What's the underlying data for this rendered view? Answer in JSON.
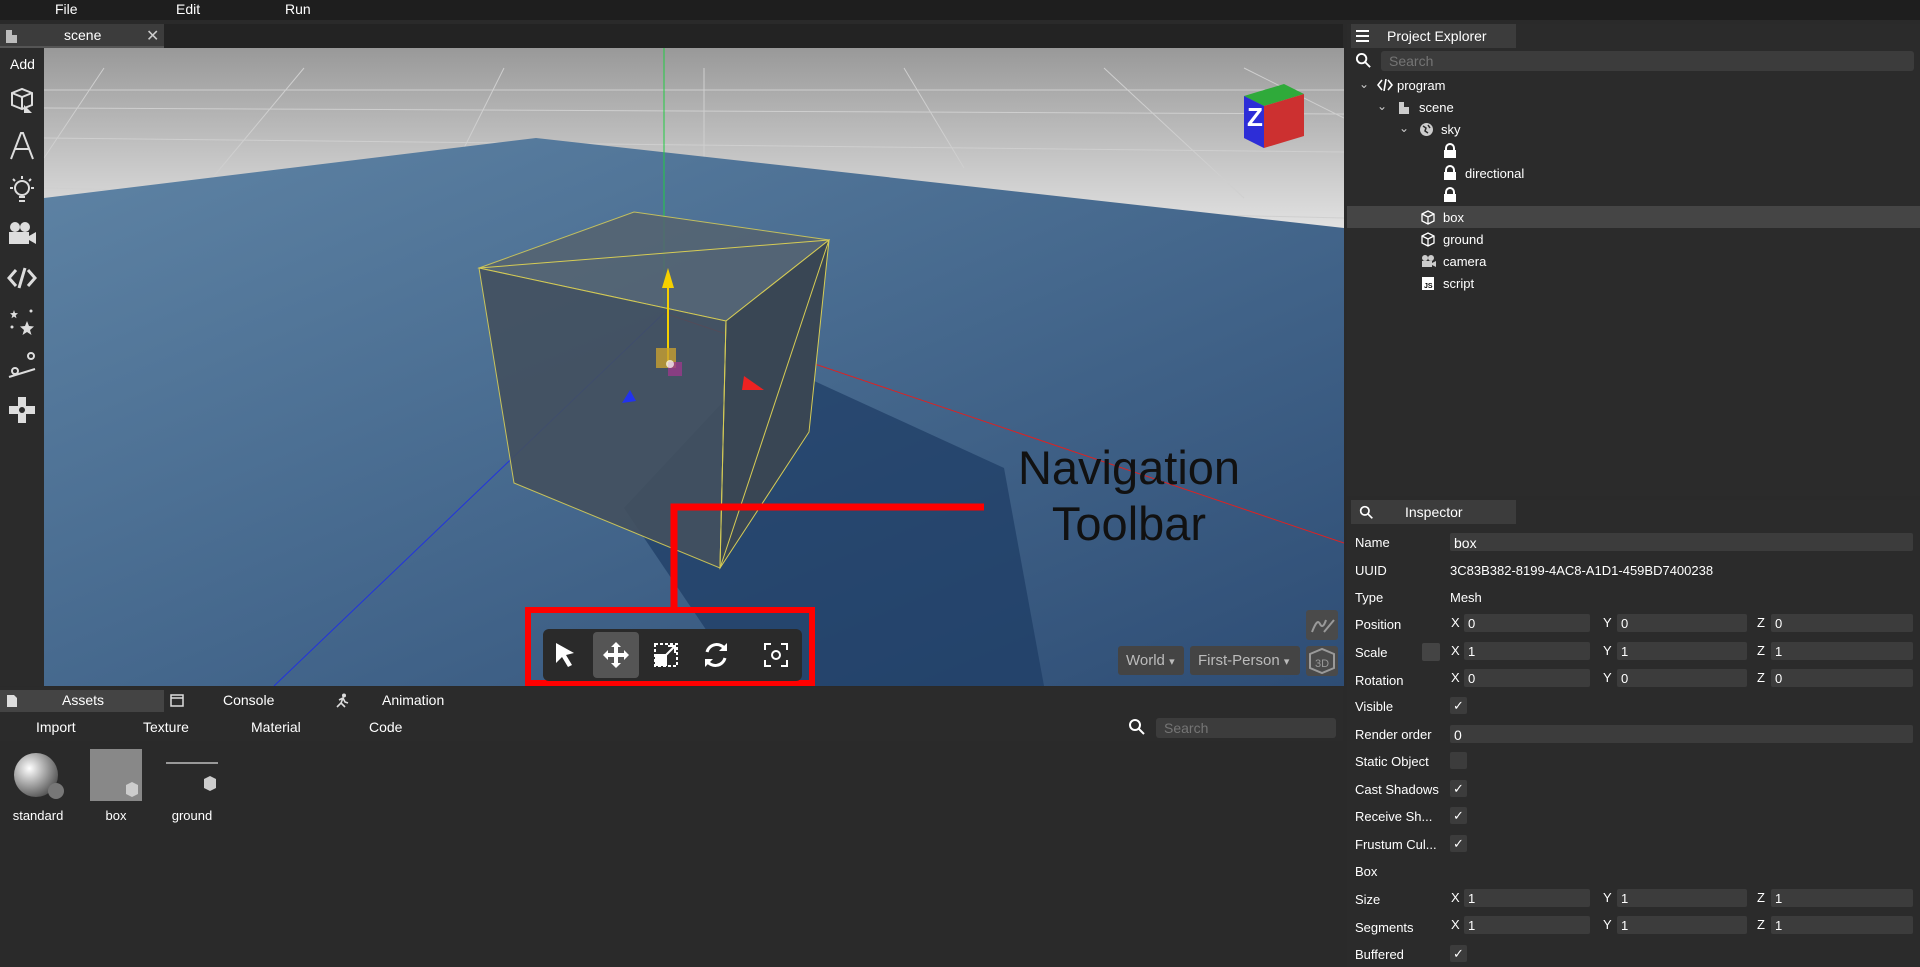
{
  "menubar": {
    "file": "File",
    "edit": "Edit",
    "run": "Run"
  },
  "tabs": {
    "scene": "scene"
  },
  "leftbar": {
    "add": "Add"
  },
  "viewport": {
    "orientation_cube_label": "Z",
    "dropdown_space": "World",
    "dropdown_camera": "First-Person",
    "annotation_line1": "Navigation",
    "annotation_line2": "Toolbar"
  },
  "bottom": {
    "tabs": [
      "Assets",
      "Console",
      "Animation"
    ],
    "tools": [
      "Import",
      "Texture",
      "Material",
      "Code"
    ],
    "search_placeholder": "Search",
    "assets": [
      "standard",
      "box",
      "ground"
    ]
  },
  "explorer": {
    "title": "Project Explorer",
    "search_placeholder": "Search",
    "tree": {
      "program": "program",
      "scene": "scene",
      "sky": "sky",
      "directional": "directional",
      "box": "box",
      "ground": "ground",
      "camera": "camera",
      "script": "script"
    }
  },
  "inspector": {
    "title": "Inspector",
    "labels": {
      "name": "Name",
      "uuid": "UUID",
      "type": "Type",
      "position": "Position",
      "scale": "Scale",
      "rotation": "Rotation",
      "visible": "Visible",
      "render_order": "Render order",
      "static_object": "Static Object",
      "cast_shadows": "Cast Shadows",
      "receive_shadows": "Receive Sh...",
      "frustum": "Frustum Cul...",
      "box_section": "Box",
      "size": "Size",
      "segments": "Segments",
      "buffered": "Buffered"
    },
    "values": {
      "name": "box",
      "uuid": "3C83B382-8199-4AC8-A1D1-459BD7400238",
      "type": "Mesh",
      "position": {
        "x": "0",
        "y": "0",
        "z": "0"
      },
      "scale": {
        "x": "1",
        "y": "1",
        "z": "1"
      },
      "rotation": {
        "x": "0",
        "y": "0",
        "z": "0"
      },
      "render_order": "0",
      "size": {
        "x": "1",
        "y": "1",
        "z": "1"
      },
      "segments": {
        "x": "1",
        "y": "1",
        "z": "1"
      }
    },
    "axis": {
      "x": "X",
      "y": "Y",
      "z": "Z"
    },
    "check": "✓",
    "colors": {
      "accent_red": "#ff0000",
      "panel": "#2b2b2b",
      "field": "#3c3c3c"
    }
  }
}
